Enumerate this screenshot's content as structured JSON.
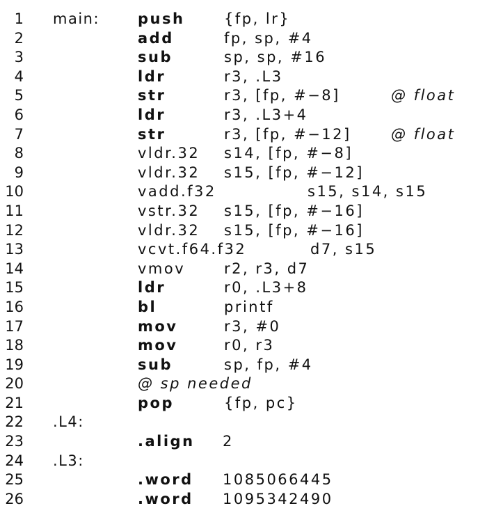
{
  "lines": [
    {
      "n": "1",
      "label": "main:",
      "op": "push",
      "args": "{fp, lr}"
    },
    {
      "n": "2",
      "op": "add",
      "args": "fp, sp, #4"
    },
    {
      "n": "3",
      "op": "sub",
      "args": "sp, sp, #16"
    },
    {
      "n": "4",
      "op": "ldr",
      "args": "r3, .L3"
    },
    {
      "n": "5",
      "op": "str",
      "args": "r3, [fp, #−8]",
      "comment": "@ float"
    },
    {
      "n": "6",
      "op": "ldr",
      "args": "r3, .L3+4"
    },
    {
      "n": "7",
      "op": "str",
      "args": "r3, [fp, #−12]",
      "comment": "@ float"
    },
    {
      "n": "8",
      "op": "vldr.32",
      "args": "s14, [fp, #−8]"
    },
    {
      "n": "9",
      "op": "vldr.32",
      "args": "s15, [fp, #−12]"
    },
    {
      "n": "10",
      "op": "vadd.f32",
      "args": "s15, s14, s15"
    },
    {
      "n": "11",
      "op": "vstr.32",
      "args": "s15, [fp, #−16]"
    },
    {
      "n": "12",
      "op": "vldr.32",
      "args": "s15, [fp, #−16]"
    },
    {
      "n": "13",
      "op": "vcvt.f64.f32",
      "args": "d7, s15"
    },
    {
      "n": "14",
      "op": "vmov",
      "args": "r2, r3, d7"
    },
    {
      "n": "15",
      "op": "ldr",
      "args": "r0, .L3+8"
    },
    {
      "n": "16",
      "op": "bl",
      "args": "printf"
    },
    {
      "n": "17",
      "op": "mov",
      "args": "r3, #0"
    },
    {
      "n": "18",
      "op": "mov",
      "args": "r0, r3"
    },
    {
      "n": "19",
      "op": "sub",
      "args": "sp, fp, #4"
    },
    {
      "n": "20",
      "fullcomment": "@ sp needed"
    },
    {
      "n": "21",
      "op": "pop",
      "args": "{fp, pc}"
    },
    {
      "n": "22",
      "label": ".L4:"
    },
    {
      "n": "23",
      "op": ".align",
      "args": "2"
    },
    {
      "n": "24",
      "label": ".L3:"
    },
    {
      "n": "25",
      "op": ".word",
      "args": "1085066445"
    },
    {
      "n": "26",
      "op": ".word",
      "args": "1095342490"
    }
  ]
}
